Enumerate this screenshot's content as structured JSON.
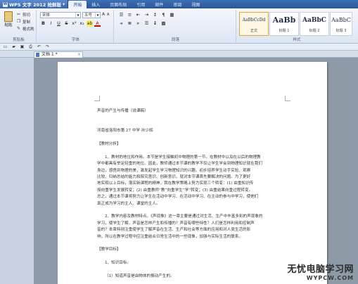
{
  "app": {
    "title": "WPS 文字 2012 抢鲜版"
  },
  "menu": {
    "tabs": [
      "开始",
      "插入",
      "页面布局",
      "引用",
      "邮件",
      "审阅",
      "视图"
    ],
    "active": 0
  },
  "ribbon": {
    "clipboard": {
      "paste": "粘贴",
      "cut": "剪切",
      "copy": "复制",
      "format_painter": "格式刷",
      "label": "剪贴板"
    },
    "font": {
      "name": "宋体",
      "size": "五号",
      "bold": "B",
      "italic": "I",
      "underline": "U",
      "strike": "S",
      "color_a": "A",
      "label": "字体"
    },
    "paragraph": {
      "label": "段落"
    },
    "styles": {
      "items": [
        {
          "sample": "AaBbCcDd",
          "name": "正文"
        },
        {
          "sample": "AaBb",
          "name": "标题 1"
        },
        {
          "sample": "AaBbC",
          "name": "标题 2"
        },
        {
          "sample": "AaBbC",
          "name": "标题 3"
        }
      ],
      "label": "样式"
    }
  },
  "doc_tab": {
    "name": "文档 1 *",
    "close": "×"
  },
  "document": {
    "lines": [
      {
        "text": "声音的产生与传播（说课稿）",
        "indent": false
      },
      {
        "text": "",
        "indent": false
      },
      {
        "text": "",
        "indent": false
      },
      {
        "text": "河南省洛阳市第 27 中学   孙少辉",
        "indent": false
      },
      {
        "text": "",
        "indent": false
      },
      {
        "text": "【教材分析】",
        "indent": false
      },
      {
        "text": "",
        "indent": false
      },
      {
        "text": "1、教材的地位和作用。本节是学生接触初中物理的第一节。在教材中以及在以后的物理教",
        "indent": true
      },
      {
        "text": "学中都具有举足轻重的地位。因此，教师通过本节课的教学不仅让学生学会到物理知识就在我们",
        "indent": false
      },
      {
        "text": "身边，感悟到物理的美，激发起学生学习物理知识的兴趣。初步培养学生动手实验、观察",
        "indent": false
      },
      {
        "text": "比较、归纳总结的能力和探究意识、创新意识。就对本节课首先要解决的问题。为了更好",
        "indent": false
      },
      {
        "text": "地实现以上目标，落实新课程的精神，我在教学策略上努力实现三个转变：(1) 由重知识传",
        "indent": false
      },
      {
        "text": "授向重学生发展转变；(2) 由重教师“教”向重学生“学”转变；(3) 由重结果向重过程转变。",
        "indent": false
      },
      {
        "text": "总之，通过本节课将努力让学生在活动中学习、在活动中学习、在主动的参与中学习，使他们",
        "indent": false
      },
      {
        "text": "真正成为学习的主人、课堂的主人。",
        "indent": false
      },
      {
        "text": "",
        "indent": false
      },
      {
        "text": "2、教学内容及教材特点。《声现象》这一章主要是通过对生活、生产中丰富多彩的声现象的",
        "indent": true
      },
      {
        "text": "学习，使学生了解，声音是怎样产生和传播的？声音有哪些特性？人们是怎样利用和控制声",
        "indent": false
      },
      {
        "text": "音的？本章特别注重使学生了解声音在生活、生产和社会等方面的应用和对人类生活的影",
        "indent": false
      },
      {
        "text": "响，所以在教学过程中应注重结合日常生活中的一些现象，加强与实际生活的联系。",
        "indent": false
      },
      {
        "text": "",
        "indent": false
      },
      {
        "text": "【教学目标】",
        "indent": false
      },
      {
        "text": "",
        "indent": false
      },
      {
        "text": "1、知识目标。",
        "indent": true
      },
      {
        "text": "",
        "indent": false
      },
      {
        "text": "（1）知道声音是由物体的振动产生的。",
        "indent": true
      }
    ]
  },
  "watermark": {
    "main": "无忧电脑学习网",
    "url": "WYPCW.COM"
  }
}
